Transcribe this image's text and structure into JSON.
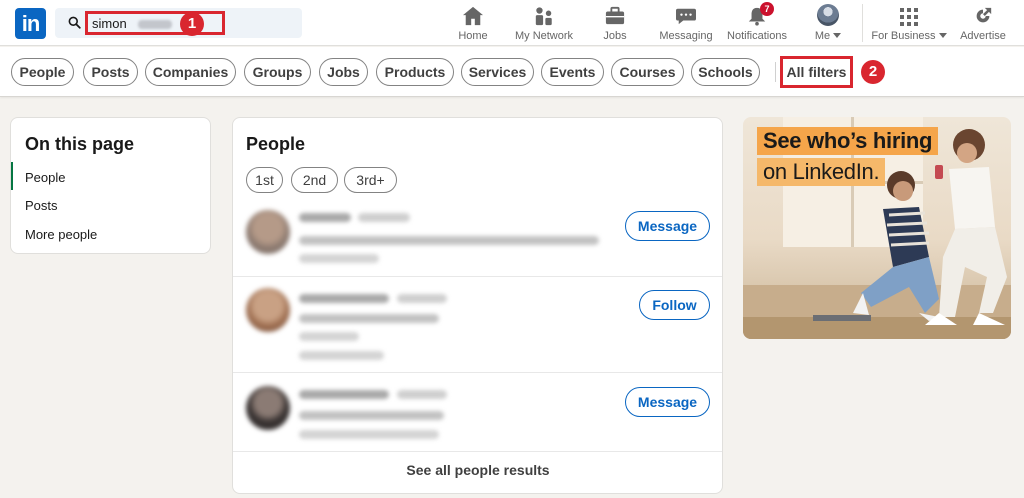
{
  "brand": {
    "logo_text": "in",
    "accent": "#0a66c2"
  },
  "search": {
    "query": "simon",
    "icon": "search-icon",
    "step_badge": "1"
  },
  "nav": {
    "items": [
      {
        "label": "Home",
        "icon": "home-icon"
      },
      {
        "label": "My Network",
        "icon": "network-icon"
      },
      {
        "label": "Jobs",
        "icon": "briefcase-icon"
      },
      {
        "label": "Messaging",
        "icon": "messaging-icon"
      },
      {
        "label": "Notifications",
        "icon": "bell-icon",
        "count": "7"
      },
      {
        "label": "Me",
        "icon": "avatar"
      },
      {
        "label": "For Business",
        "icon": "grid-icon"
      },
      {
        "label": "Advertise",
        "icon": "advertise-icon"
      }
    ]
  },
  "filters": {
    "pills": [
      "People",
      "Posts",
      "Companies",
      "Groups",
      "Jobs",
      "Products",
      "Services",
      "Events",
      "Courses",
      "Schools"
    ],
    "all_filters": "All filters",
    "step_badge": "2"
  },
  "toc": {
    "title": "On this page",
    "items": [
      "People",
      "Posts",
      "More people"
    ]
  },
  "people": {
    "title": "People",
    "connection_filters": [
      "1st",
      "2nd",
      "3rd+"
    ],
    "results": [
      {
        "action": "Message"
      },
      {
        "action": "Follow"
      },
      {
        "action": "Message"
      }
    ],
    "see_all": "See all people results"
  },
  "ad": {
    "line1": "See who’s hiring",
    "line2": "on LinkedIn."
  }
}
